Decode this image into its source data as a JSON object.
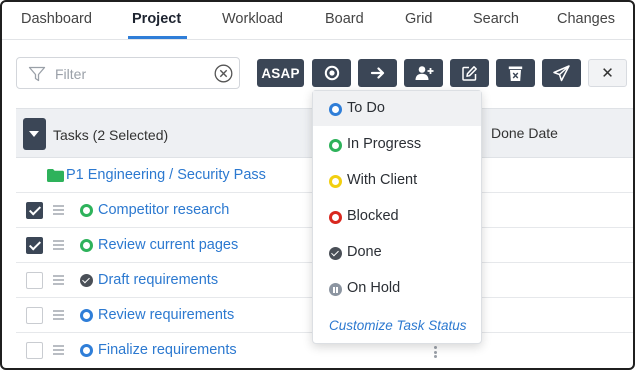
{
  "tabs": [
    {
      "label": "Dashboard",
      "active": false
    },
    {
      "label": "Project",
      "active": true
    },
    {
      "label": "Workload",
      "active": false
    },
    {
      "label": "Board",
      "active": false
    },
    {
      "label": "Grid",
      "active": false
    },
    {
      "label": "Search",
      "active": false
    },
    {
      "label": "Changes",
      "active": false
    }
  ],
  "filter": {
    "placeholder": "Filter",
    "icon": "filter-icon",
    "clear_icon": "clear-icon"
  },
  "toolbar": {
    "asap_label": "ASAP",
    "buttons": [
      "status-icon",
      "arrow-right-icon",
      "add-user-icon",
      "edit-icon",
      "delete-icon",
      "send-icon",
      "close-icon"
    ],
    "close_label": "✕"
  },
  "table": {
    "header_tasks": "Tasks (2 Selected)",
    "header_done": "Done Date",
    "group": "P1 Engineering / Security Pass",
    "rows": [
      {
        "name": "Competitor research",
        "checked": true,
        "status": "In Progress"
      },
      {
        "name": "Review current pages",
        "checked": true,
        "status": "In Progress"
      },
      {
        "name": "Draft requirements",
        "checked": false,
        "status": "Done"
      },
      {
        "name": "Review requirements",
        "checked": false,
        "status": "To Do"
      },
      {
        "name": "Finalize requirements",
        "checked": false,
        "status": "To Do"
      }
    ]
  },
  "status_menu": {
    "items": [
      {
        "label": "To Do",
        "color": "#2f7ed8"
      },
      {
        "label": "In Progress",
        "color": "#2eb25b"
      },
      {
        "label": "With Client",
        "color": "#f2cf10"
      },
      {
        "label": "Blocked",
        "color": "#d9281f"
      },
      {
        "label": "Done",
        "color": "#4a4f57"
      },
      {
        "label": "On Hold",
        "color": "#8c95a1"
      }
    ],
    "customize": "Customize Task Status"
  },
  "colors": {
    "accent": "#2f7ed8",
    "toolbar_button": "#3b4656",
    "link": "#2c79d0"
  }
}
